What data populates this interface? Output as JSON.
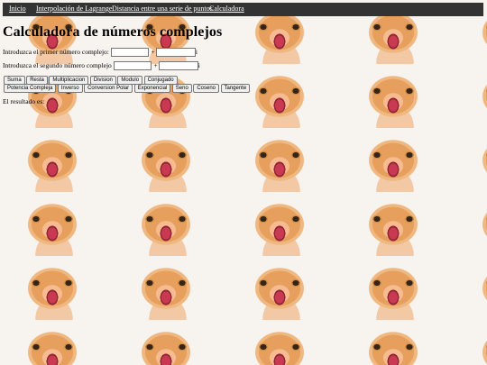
{
  "nav": {
    "items": [
      {
        "label": "Inicio"
      },
      {
        "label": "Interpolación de Lagrange"
      },
      {
        "label": "Distancia entre una serie de puntos"
      },
      {
        "label": "Calculadora"
      }
    ]
  },
  "page": {
    "title": "Calculadora de números complejos"
  },
  "form": {
    "first_label": "Introduzca el primer número complejo:",
    "second_label": "Introduzca el segundo número complejo",
    "plus_sign": "+",
    "i_suffix": "i",
    "first_real_value": "",
    "first_imag_value": "",
    "second_real_value": "",
    "second_imag_value": ""
  },
  "buttons": {
    "row1": [
      "Suma",
      "Resta",
      "Multiplicacion",
      "Division",
      "Modulo",
      "Conjugado"
    ],
    "row2": [
      "Potencia Compleja",
      "Inverso",
      "Conversion Polar",
      "Exponencial",
      "Seno",
      "Coseno",
      "Tangente"
    ]
  },
  "result": {
    "text": "El resultado es:"
  },
  "colors": {
    "navbar_bg": "#333333",
    "nav_link": "#ffffff"
  },
  "background": {
    "pattern": "tiled-cat-photo"
  }
}
